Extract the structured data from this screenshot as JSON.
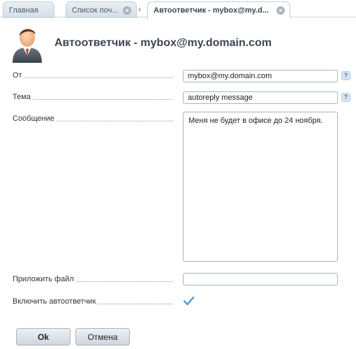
{
  "tabs": [
    {
      "label": "Главная"
    },
    {
      "label": "Список поч..."
    },
    {
      "label": "Автоответчик - mybox@my.d..."
    }
  ],
  "page": {
    "title": "Автоответчик - mybox@my.domain.com"
  },
  "form": {
    "from_label": "От",
    "from_value": "mybox@my.domain.com",
    "subject_label": "Тема",
    "subject_value": "autoreply message",
    "message_label": "Сообщение",
    "message_value": "Меня не будет в офисе до 24 ноября.",
    "attach_label": "Приложить файл",
    "attach_value": "",
    "enable_label": "Включить автоответчик",
    "enable_checked": true,
    "help_glyph": "?"
  },
  "buttons": {
    "ok": "Ok",
    "cancel": "Отмена"
  },
  "colors": {
    "accent": "#4a90c8",
    "check": "#4a9bd8"
  }
}
